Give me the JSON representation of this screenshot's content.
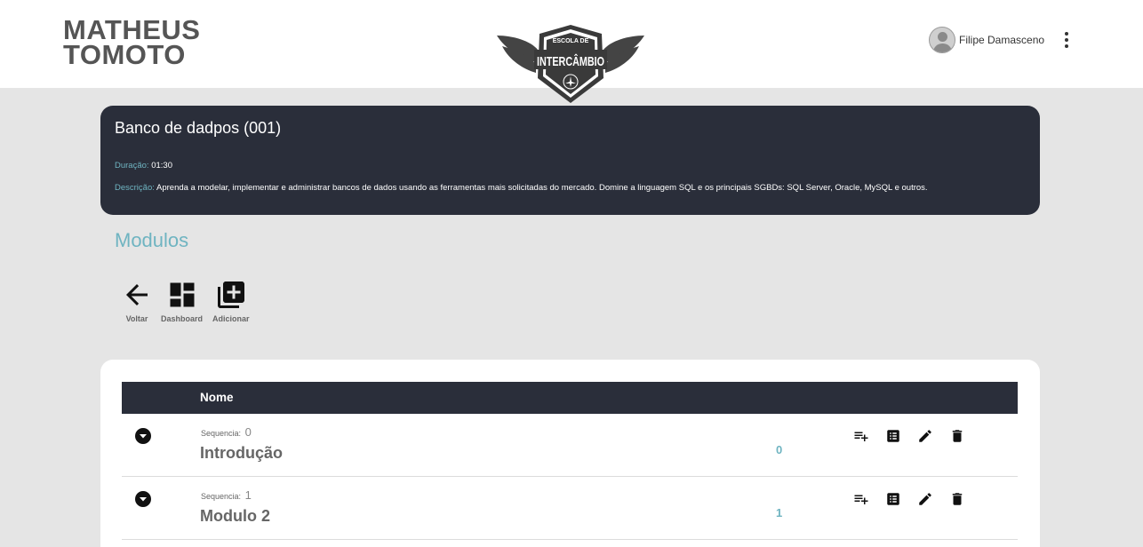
{
  "header": {
    "brand_line1": "MATHEUS",
    "brand_line2": "TOMOTO",
    "center_logo_top": "ESCOLA DE",
    "center_logo_main": "INTERCÂMBIO",
    "user_name": "Filipe Damasceno"
  },
  "course": {
    "title": "Banco de dadpos (001)",
    "duration_label": "Duração:",
    "duration_value": "01:30",
    "description_label": "Descrição:",
    "description_value": "Aprenda a modelar, implementar e administrar bancos de dados usando as ferramentas mais solicitadas do mercado. Domine a linguagem SQL e os principais SGBDs: SQL Server, Oracle, MySQL e outros."
  },
  "section_title": "Modulos",
  "toolbar": {
    "back_label": "Voltar",
    "dashboard_label": "Dashboard",
    "add_label": "Adicionar"
  },
  "table": {
    "header_name": "Nome",
    "sequence_label": "Sequencia:",
    "rows": [
      {
        "sequence": "0",
        "name": "Introdução",
        "count": "0"
      },
      {
        "sequence": "1",
        "name": "Modulo 2",
        "count": "1"
      }
    ]
  },
  "colors": {
    "accent": "#6fb4c1",
    "dark": "#2a2e3a",
    "background": "#e5e5e5"
  },
  "icons": [
    "arrow-back-icon",
    "dashboard-icon",
    "library-add-icon",
    "playlist-add-icon",
    "list-alt-icon",
    "edit-icon",
    "delete-icon",
    "dropdown-circle-icon",
    "more-vert-icon"
  ]
}
